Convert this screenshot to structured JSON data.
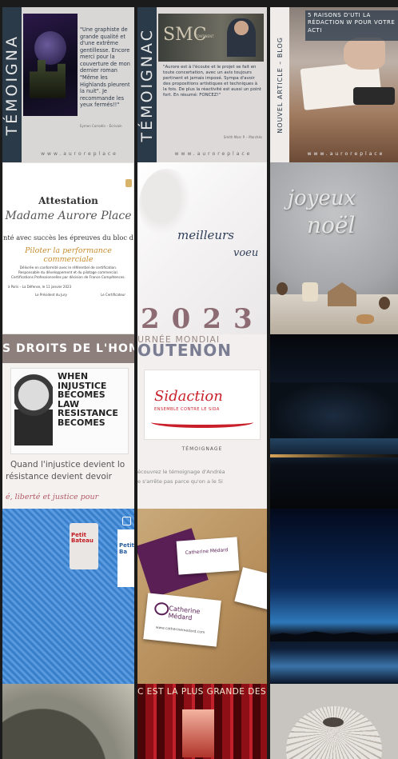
{
  "tiles": {
    "t1": {
      "side_text": "TÉMOIGNA",
      "quote": "\"Une graphiste de grande qualité et d'une extrême gentillesse. Encore merci pour la couverture de mon dernier roman \"Même les Highlands pleurent la nuit\". Je recommande les yeux fermés!!\"",
      "author": "Eymen Corrodin – Écrivain",
      "website": "www.auroreplace"
    },
    "t2": {
      "side_text": "TÉMOIGNAC",
      "logo": "SMC",
      "logo_sub": "CONTINENT",
      "quote": "\"Aurore est à l'écoute et le projet se fait en toute concertation, avec un avis toujours pertinent et jamais imposé. Sympa d'avoir des propositions artistiques et techniques à la fois. De plus la réactivité est aussi un point fort. En résumé: FONCEZ!\"",
      "author": "Smith Marc P. – Marchés",
      "website": "www.auroreplace"
    },
    "t3": {
      "side_text": "NOUVEL ARTICLE – BLOG",
      "overlay": "5 RAISONS D'UTI LA RÉDACTION W POUR VOTRE ACTI",
      "website": "www.auroreplace"
    },
    "t4": {
      "title": "Attestation",
      "name": "Madame Aurore Place",
      "line1": "nté avec succès les épreuves du bloc de compét",
      "highlight": "Piloter la performance commerciale",
      "body": "Délivrée en conformité avec le référentiel de certification. Responsable du développement et du pilotage commercial. Certifications Professionnelles par décision de France Compétences.",
      "place_date": "à Paris – La Défense, le 11 janvier 2023",
      "signature1": "Le Président du Jury",
      "signature2": "Le Certificateur"
    },
    "t5": {
      "greeting1": "meilleurs",
      "greeting2": "voeu",
      "year": "2023"
    },
    "t6": {
      "greeting1": "joyeux",
      "greeting2": "noël"
    },
    "t7": {
      "banner": "S DROITS DE L'HOM",
      "sign_text": "WHEN INJUSTICE BECOMES LAW RESISTANCE BECOMES",
      "caption1": "Quand l'injustice devient lo",
      "caption2": "résistance devient devoir",
      "footer": "é, liberté et justice pour"
    },
    "t8": {
      "top": "URNÉE MONDIAI",
      "banner": "OUTENON",
      "logo": "Sidaction",
      "logo_sub": "ENSEMBLE CONTRE LE SIDA",
      "label": "TÉMOIGNAGE",
      "caption1": "écouvrez le témoignage d'Andréa",
      "caption2": "e s'arrête pas parce qu'on a le Si"
    },
    "t10": {
      "label_brand": "Petit Bateau",
      "label_brand2": "Petit Ba"
    },
    "t11": {
      "card_name": "Catherine Médard",
      "card_site": "www.catherinemedard.com"
    },
    "t14": {
      "banner": "C EST LA PLUS GRANDE DES"
    }
  }
}
